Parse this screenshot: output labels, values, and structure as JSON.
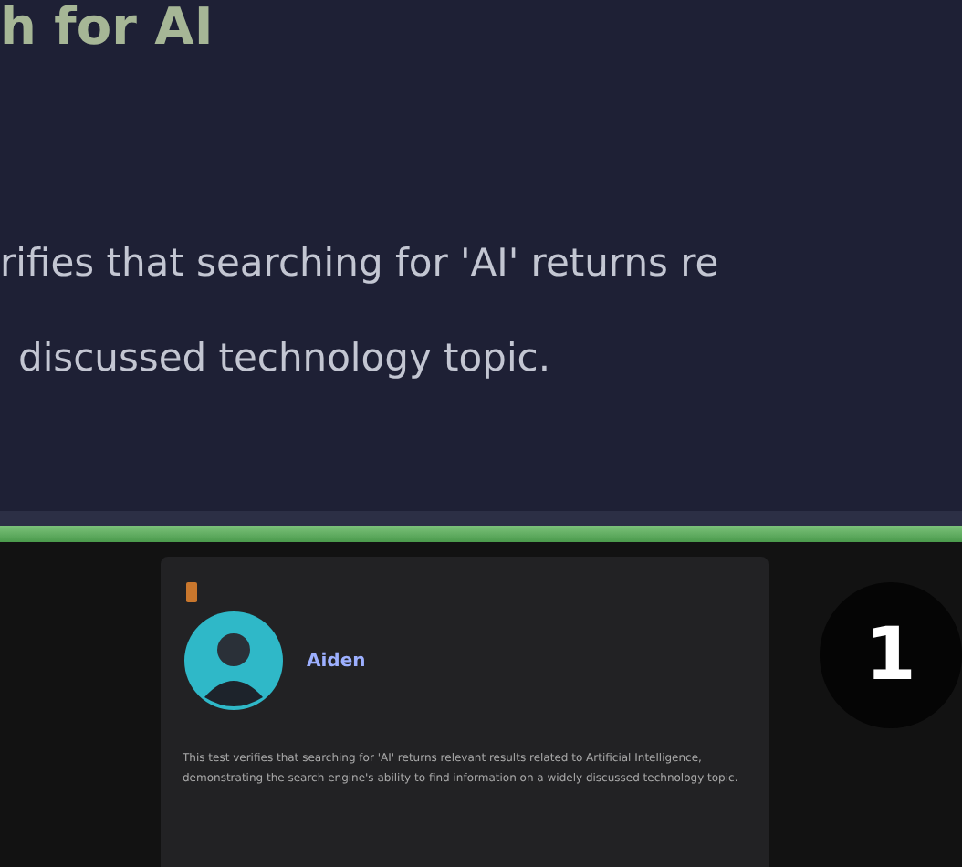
{
  "header": {
    "title": "h for AI",
    "description_lines": [
      "rifies that searching for 'AI' returns re",
      "discussed technology topic."
    ]
  },
  "progress": {
    "level": 1
  },
  "card": {
    "author": "Aiden",
    "description": "This test verifies that searching for 'AI' returns relevant results related to Artificial Intelligence, demonstrating the search engine's ability to find information on a widely discussed technology topic."
  },
  "rank_badge": "1"
}
